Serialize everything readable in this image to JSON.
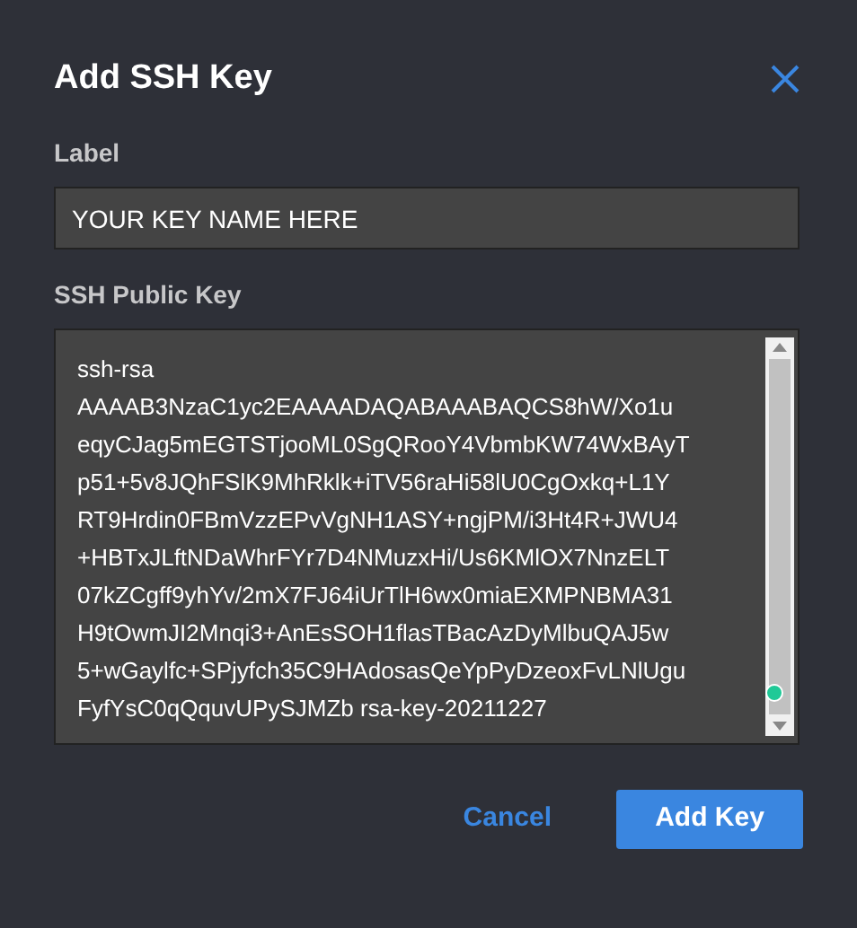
{
  "dialog": {
    "title": "Add SSH Key"
  },
  "label_field": {
    "label": "Label",
    "value": "YOUR KEY NAME HERE"
  },
  "key_field": {
    "label": "SSH Public Key",
    "value": "ssh-rsa\nAAAAB3NzaC1yc2EAAAADAQABAAABAQCS8hW/Xo1u\neqyCJag5mEGTSTjooML0SgQRooY4VbmbKW74WxBAyT\np51+5v8JQhFSlK9MhRklk+iTV56raHi58lU0CgOxkq+L1Y\nRT9Hrdin0FBmVzzEPvVgNH1ASY+ngjPM/i3Ht4R+JWU4\n+HBTxJLftNDaWhrFYr7D4NMuzxHi/Us6KMlOX7NnzELT\n07kZCgff9yhYv/2mX7FJ64iUrTlH6wx0miaEXMPNBMA31\nH9tOwmJI2Mnqi3+AnEsSOH1flasTBacAzDyMlbuQAJ5w\n5+wGaylfc+SPjyfch35C9HAdosasQeYpPyDzeoxFvLNlUgu\nFyfYsC0qQquvUPySJMZb rsa-key-20211227"
  },
  "buttons": [
    {
      "label": "Cancel",
      "kind": "link"
    },
    {
      "label": "Add Key",
      "kind": "primary"
    }
  ]
}
